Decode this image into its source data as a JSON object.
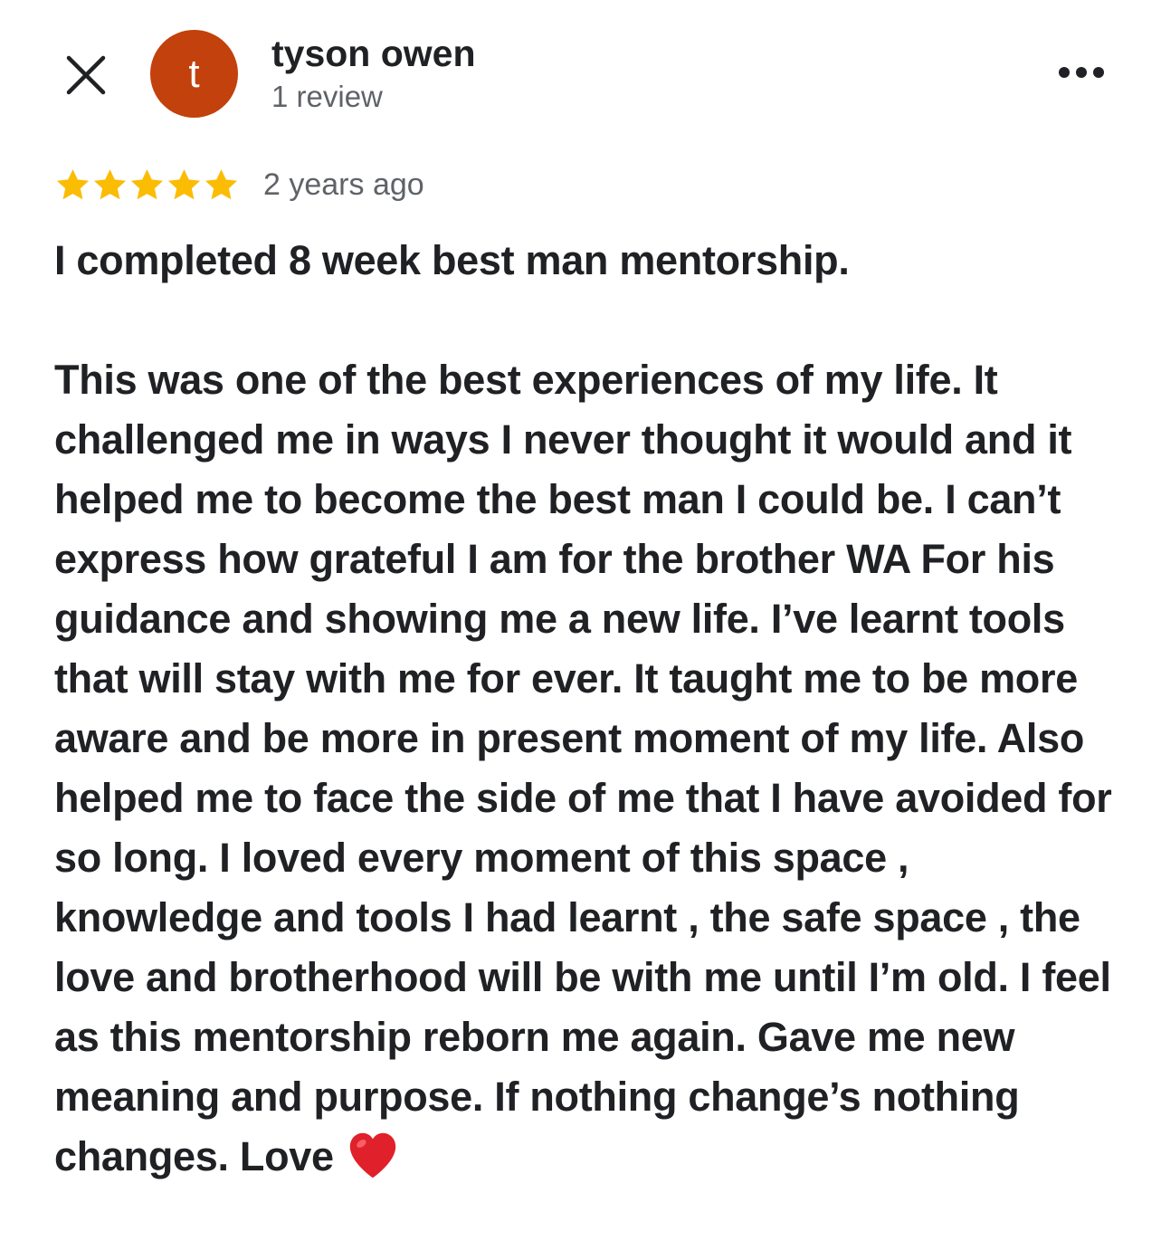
{
  "header": {
    "close_icon": "close-icon",
    "avatar_letter": "t",
    "avatar_color": "#c2410c",
    "user_name": "tyson owen",
    "review_count": "1 review",
    "more_icon": "more-horizontal-icon"
  },
  "review": {
    "rating": 5,
    "rating_max": 5,
    "star_color": "#fbbc04",
    "time_ago": "2 years ago",
    "paragraph_1": "I completed 8 week best man mentorship.",
    "paragraph_2": "This was one of the best experiences of my life. It challenged me in ways I never thought it would and it helped me to become the best man I could be. I can’t express how grateful I  am for the brother WA For his guidance and showing me a new life. I’ve learnt tools that will stay with me for ever. It taught me to be more aware and be more in present moment of my life. Also helped me to face the side of me that I have avoided for so long. I loved every moment of this space , knowledge and tools I had learnt , the safe space , the love and brotherhood will be with me until I’m old. I feel as this mentorship reborn me again. Gave me new meaning and purpose. If nothing change’s nothing changes. Love",
    "trailing_emoji": "red-heart-icon"
  }
}
